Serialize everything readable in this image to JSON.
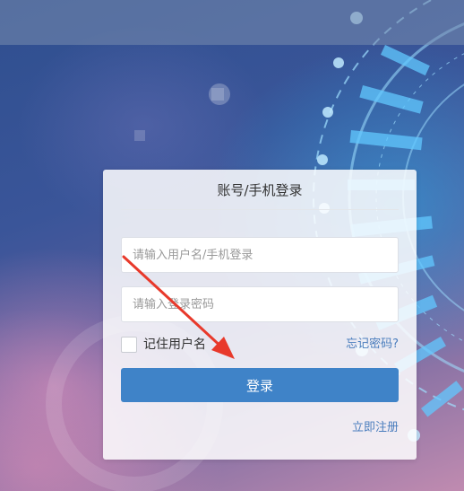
{
  "login": {
    "title": "账号/手机登录",
    "username_placeholder": "请输入用户名/手机登录",
    "password_placeholder": "请输入登录密码",
    "remember_label": "记住用户名",
    "forgot_label": "忘记密码?",
    "submit_label": "登录",
    "register_label": "立即注册"
  },
  "colors": {
    "accent": "#3f83c8",
    "link": "#4a7dbd",
    "arrow": "#e8392b"
  },
  "icons": {
    "annotation": "red-arrow-icon",
    "checkbox": "checkbox-unchecked-icon"
  }
}
